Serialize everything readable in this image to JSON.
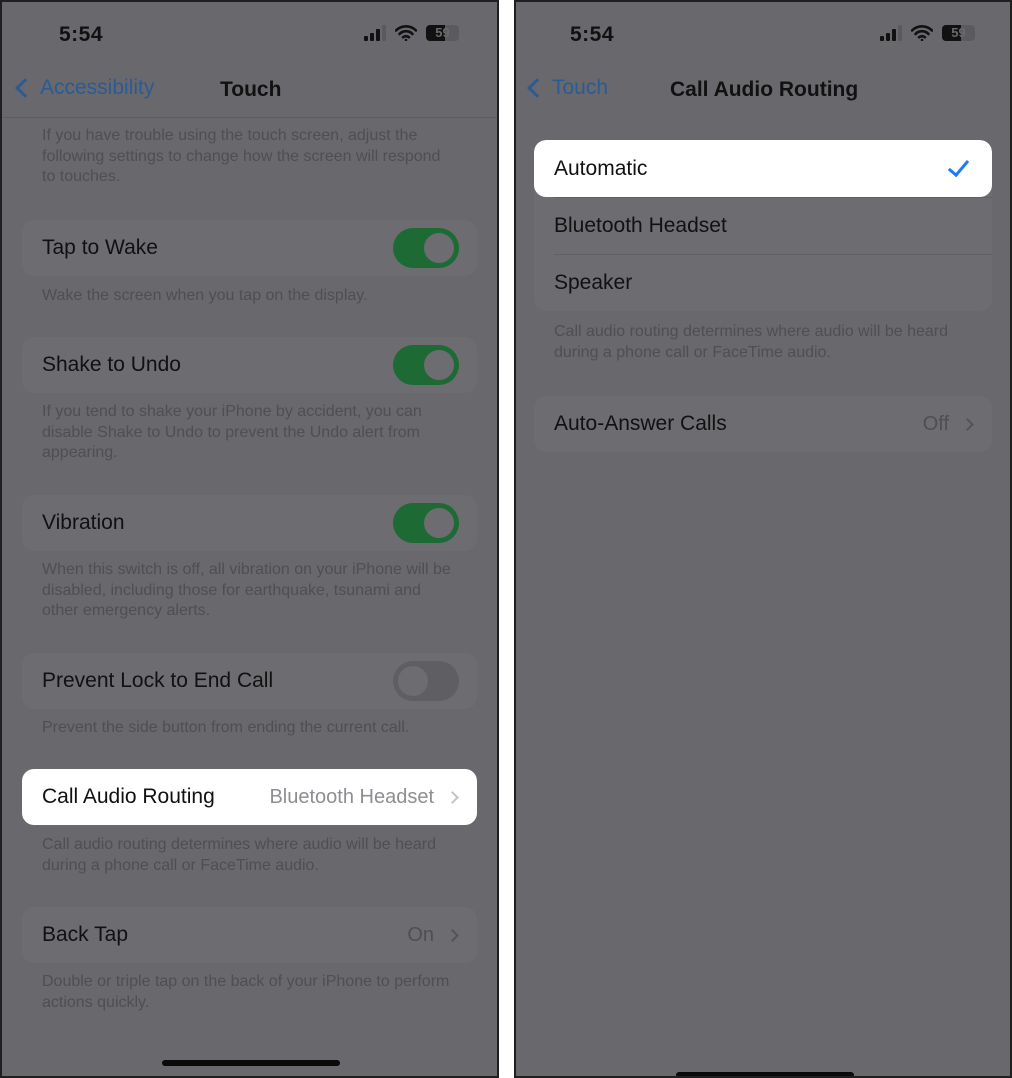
{
  "left_screen": {
    "status_bar": {
      "time": "5:54",
      "battery_level": "59",
      "battery_percent": 59
    },
    "nav": {
      "back_label": "Accessibility",
      "title": "Touch"
    },
    "intro_text": "If you have trouble using the touch screen, adjust the following settings to change how the screen will respond to touches.",
    "settings": [
      {
        "label": "Tap to Wake",
        "type": "toggle",
        "on": true,
        "footer": "Wake the screen when you tap on the display."
      },
      {
        "label": "Shake to Undo",
        "type": "toggle",
        "on": true,
        "footer": "If you tend to shake your iPhone by accident, you can disable Shake to Undo to prevent the Undo alert from appearing."
      },
      {
        "label": "Vibration",
        "type": "toggle",
        "on": true,
        "footer": "When this switch is off, all vibration on your iPhone will be disabled, including those for earthquake, tsunami and other emergency alerts."
      },
      {
        "label": "Prevent Lock to End Call",
        "type": "toggle",
        "on": false,
        "footer": "Prevent the side button from ending the current call."
      },
      {
        "label": "Call Audio Routing",
        "type": "link",
        "value": "Bluetooth Headset",
        "highlighted": true,
        "footer": "Call audio routing determines where audio will be heard during a phone call or FaceTime audio."
      },
      {
        "label": "Back Tap",
        "type": "link",
        "value": "On",
        "footer": "Double or triple tap on the back of your iPhone to perform actions quickly."
      }
    ]
  },
  "right_screen": {
    "status_bar": {
      "time": "5:54",
      "battery_level": "59",
      "battery_percent": 59
    },
    "nav": {
      "back_label": "Touch",
      "title": "Call Audio Routing"
    },
    "options": [
      {
        "label": "Automatic",
        "selected": true
      },
      {
        "label": "Bluetooth Headset",
        "selected": false
      },
      {
        "label": "Speaker",
        "selected": false
      }
    ],
    "options_footer": "Call audio routing determines where audio will be heard during a phone call or FaceTime audio.",
    "auto_answer": {
      "label": "Auto-Answer Calls",
      "value": "Off"
    }
  },
  "colors": {
    "accent_blue": "#1a7df5",
    "toggle_on_green": "#1d6a35",
    "dim_background": "#69686d"
  }
}
